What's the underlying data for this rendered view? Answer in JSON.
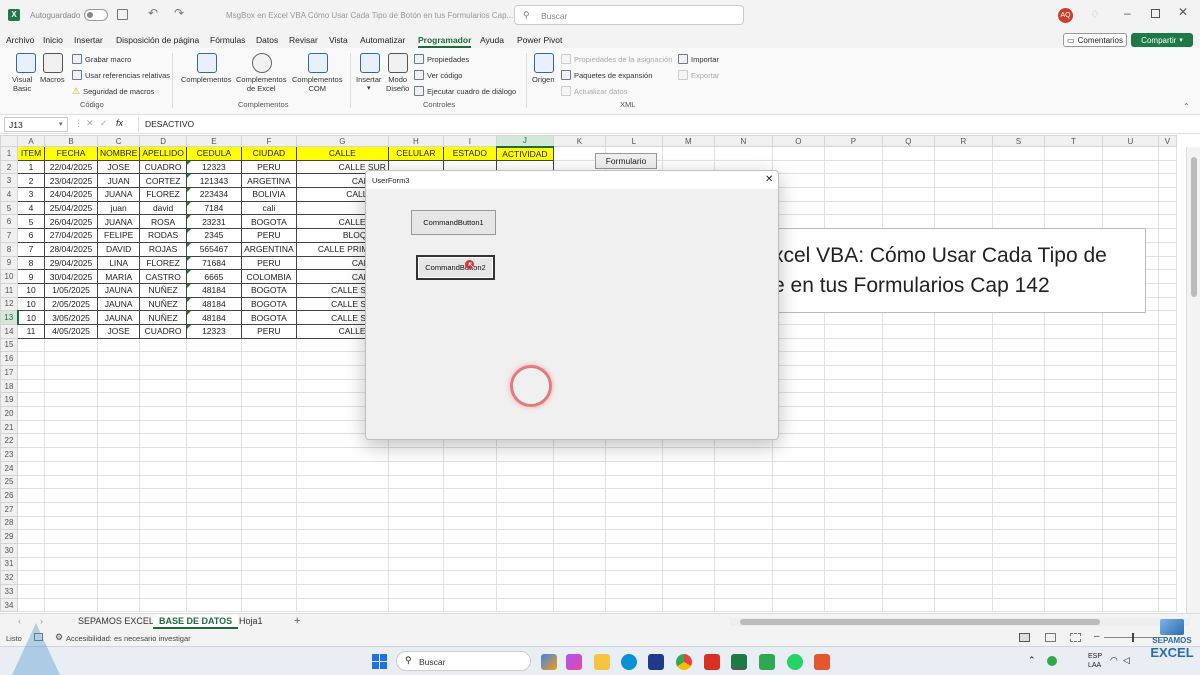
{
  "titlebar": {
    "autosave_label": "Autoguardado",
    "doc_title": "MsgBox en Excel VBA Cómo Usar Cada Tipo de Botón en tus Formularios Cap...",
    "search_placeholder": "Buscar",
    "user_initials": "AQ"
  },
  "menu": {
    "tabs": [
      "Archivo",
      "Inicio",
      "Insertar",
      "Disposición de página",
      "Fórmulas",
      "Datos",
      "Revisar",
      "Vista",
      "Automatizar",
      "Programador",
      "Ayuda",
      "Power Pivot"
    ],
    "active": "Programador",
    "comments_label": "Comentarios",
    "share_label": "Compartir"
  },
  "ribbon": {
    "codigo": {
      "visual_basic": "Visual\nBasic",
      "macros": "Macros",
      "grabar": "Grabar macro",
      "ref_rel": "Usar referencias relativas",
      "seguridad": "Seguridad de macros",
      "group": "Código"
    },
    "complementos": {
      "comp": "Complementos",
      "comp_excel": "Complementos\nde Excel",
      "comp_com": "Complementos\nCOM",
      "group": "Complementos"
    },
    "controles": {
      "insertar": "Insertar",
      "modo": "Modo\nDiseño",
      "propiedades": "Propiedades",
      "ver_codigo": "Ver código",
      "ejecutar": "Ejecutar cuadro de diálogo",
      "group": "Controles"
    },
    "xml": {
      "origen": "Origen",
      "prop_asig": "Propiedades de la asignación",
      "paquetes": "Paquetes de expansión",
      "actualizar": "Actualizar datos",
      "importar": "Importar",
      "exportar": "Exportar",
      "group": "XML"
    }
  },
  "formula_bar": {
    "name_box": "J13",
    "fx": "fx",
    "value": "DESACTIVO"
  },
  "columns": [
    "A",
    "B",
    "C",
    "D",
    "E",
    "F",
    "G",
    "H",
    "I",
    "J",
    "K",
    "L",
    "M",
    "N",
    "O",
    "P",
    "Q",
    "R",
    "S",
    "T",
    "U",
    "V"
  ],
  "selected_col": "J",
  "selected_row": 13,
  "headers": [
    "ITEM",
    "FECHA",
    "NOMBRE",
    "APELLIDO",
    "CEDULA",
    "CIUDAD",
    "CALLE",
    "CELULAR",
    "ESTADO",
    "ACTIVIDAD"
  ],
  "rows": [
    [
      "1",
      "22/04/2025",
      "JOSE",
      "CUADRO",
      "12323",
      "PERU",
      "CALLE SUR"
    ],
    [
      "2",
      "23/04/2025",
      "JUAN",
      "CORTEZ",
      "121343",
      "ARGETINA",
      "CALLE 4"
    ],
    [
      "3",
      "24/04/2025",
      "JUANA",
      "FLOREZ",
      "223434",
      "BOLIVIA",
      "CALLE 4A"
    ],
    [
      "4",
      "25/04/2025",
      "juan",
      "david",
      "7184",
      "cali",
      "sur"
    ],
    [
      "5",
      "26/04/2025",
      "JUANA",
      "ROSA",
      "23231",
      "BOGOTA",
      "CALLE SUR"
    ],
    [
      "6",
      "27/04/2025",
      "FELIPE",
      "RODAS",
      "2345",
      "PERU",
      "BLOQUE A"
    ],
    [
      "7",
      "28/04/2025",
      "DAVID",
      "ROJAS",
      "565467",
      "ARGENTINA",
      "CALLE PRIMERA"
    ],
    [
      "8",
      "29/04/2025",
      "LINA",
      "FLOREZ",
      "71684",
      "PERU",
      "CALLE 5"
    ],
    [
      "9",
      "30/04/2025",
      "MARIA",
      "CASTRO",
      "6665",
      "COLOMBIA",
      "CALLE 8"
    ],
    [
      "10",
      "1/05/2025",
      "JAUNA",
      "NUÑEZ",
      "48184",
      "BOGOTA",
      "CALLE SUR A"
    ],
    [
      "10",
      "2/05/2025",
      "JAUNA",
      "NUÑEZ",
      "48184",
      "BOGOTA",
      "CALLE SUR A"
    ],
    [
      "10",
      "3/05/2025",
      "JAUNA",
      "NUÑEZ",
      "48184",
      "BOGOTA",
      "CALLE SUR A"
    ],
    [
      "11",
      "4/05/2025",
      "JOSE",
      "CUADRO",
      "12323",
      "PERU",
      "CALLE SUR"
    ]
  ],
  "form_button_label": "Formulario",
  "banner": {
    "line1": "xcel VBA: Cómo Usar Cada Tipo de",
    "line2": "e en tus Formularios Cap 142"
  },
  "userform": {
    "title": "UserForm3",
    "button1": "CommandButton1",
    "button2": "CommandButton2"
  },
  "sheet_tabs": [
    "SEPAMOS EXCEL",
    "BASE DE DATOS",
    "Hoja1"
  ],
  "active_sheet": "BASE DE DATOS",
  "status": {
    "ready": "Listo",
    "accessibility": "Accesibilidad: es necesario investigar"
  },
  "taskbar": {
    "search_placeholder": "Buscar",
    "lang1": "ESP",
    "lang2": "LAA",
    "brand1": "SEPAMOS",
    "brand2": "EXCEL"
  },
  "colors": {
    "excel_green": "#1e6b3a",
    "header_yellow": "#ffff00",
    "share_green": "#1e7a45"
  }
}
